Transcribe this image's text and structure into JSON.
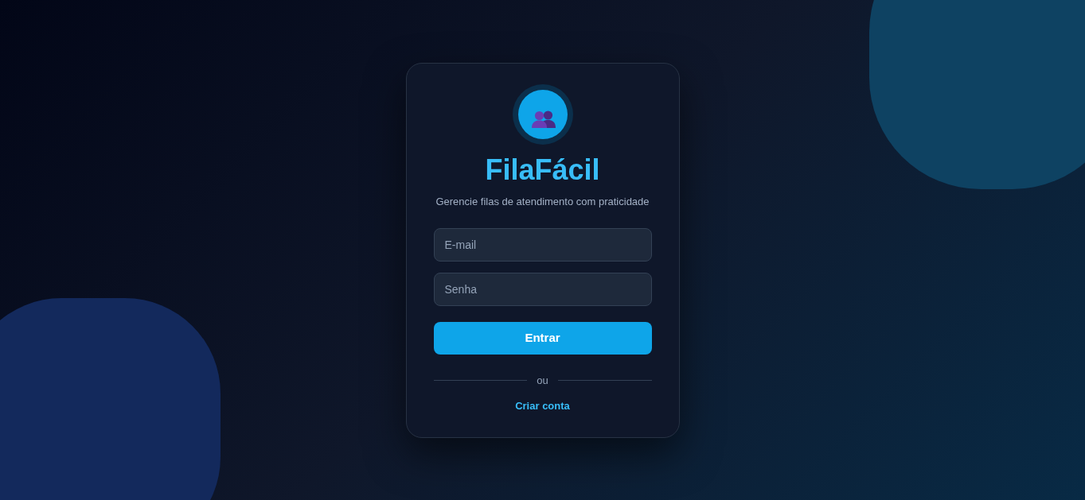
{
  "brand": {
    "title": "FilaFácil",
    "subtitle": "Gerencie filas de atendimento com praticidade"
  },
  "form": {
    "fields": [
      {
        "placeholder": "E-mail"
      },
      {
        "placeholder": "Senha"
      }
    ],
    "submit": "Entrar",
    "divider": "ou",
    "link": "Criar conta"
  }
}
